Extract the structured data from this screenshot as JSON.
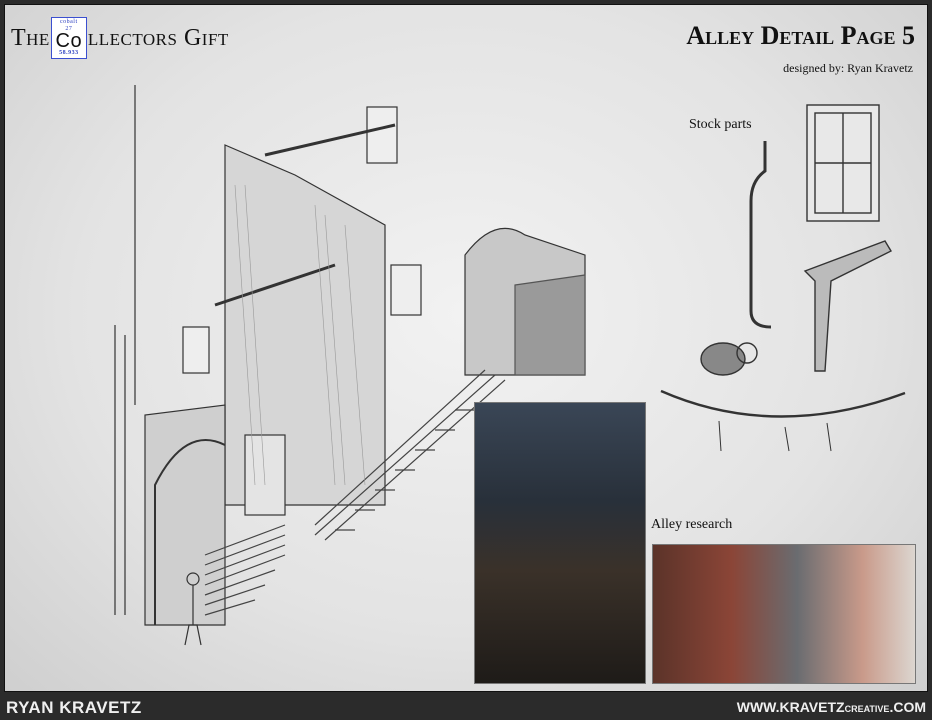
{
  "logo": {
    "word_the": "The",
    "element_name": "cobalt",
    "element_number": "27",
    "element_symbol": "Co",
    "element_weight": "58.933",
    "word_rest": "llectors Gift"
  },
  "header": {
    "title": "Alley Detail Page 5",
    "designer": "designed by: Ryan Kravetz"
  },
  "labels": {
    "stock_parts": "Stock parts",
    "alley_research": "Alley research"
  },
  "footer": {
    "name": "RYAN KRAVETZ",
    "site_prefix": "WWW.KRAVETZ",
    "site_small": "CREATIVE",
    "site_suffix": ".COM"
  },
  "colors": {
    "element_border": "#3b4fd0",
    "footer_bg": "#2b2b2b"
  }
}
